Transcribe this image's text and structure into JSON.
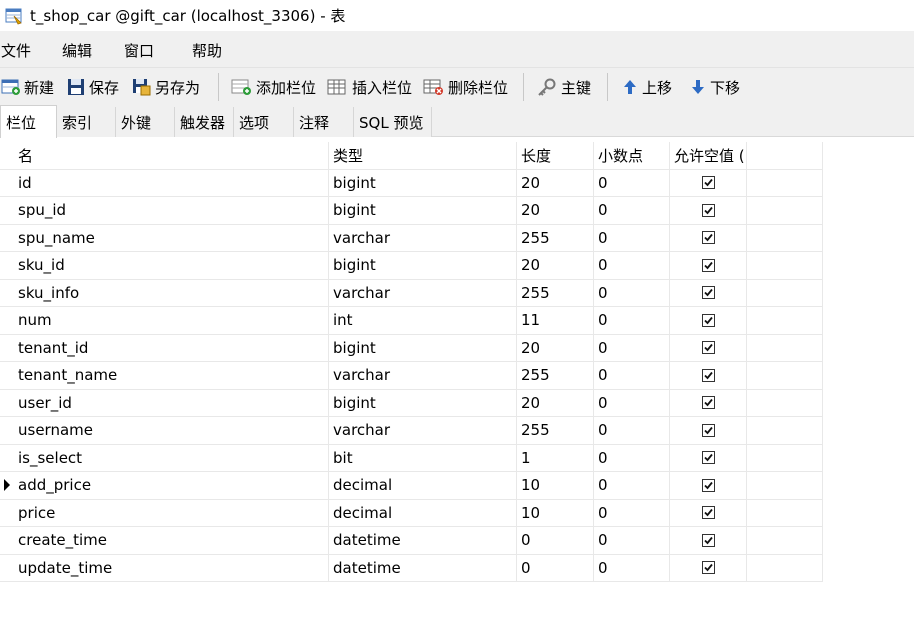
{
  "window": {
    "title": "t_shop_car @gift_car (localhost_3306) - 表",
    "icon": "table-design-icon"
  },
  "menu": [
    "文件",
    "编辑",
    "窗口",
    "帮助"
  ],
  "toolbar": {
    "new": "新建",
    "save": "保存",
    "save_as": "另存为",
    "add_field": "添加栏位",
    "insert_field": "插入栏位",
    "delete_field": "删除栏位",
    "primary_key": "主键",
    "move_up": "上移",
    "move_down": "下移"
  },
  "tabs": [
    "栏位",
    "索引",
    "外键",
    "触发器",
    "选项",
    "注释",
    "SQL 预览"
  ],
  "columns": {
    "name": "名",
    "type": "类型",
    "length": "长度",
    "decimals": "小数点",
    "allow_null": "允许空值 ("
  },
  "rows": [
    {
      "name": "id",
      "type": "bigint",
      "length": "20",
      "decimals": "0",
      "allow_null": true
    },
    {
      "name": "spu_id",
      "type": "bigint",
      "length": "20",
      "decimals": "0",
      "allow_null": true
    },
    {
      "name": "spu_name",
      "type": "varchar",
      "length": "255",
      "decimals": "0",
      "allow_null": true
    },
    {
      "name": "sku_id",
      "type": "bigint",
      "length": "20",
      "decimals": "0",
      "allow_null": true
    },
    {
      "name": "sku_info",
      "type": "varchar",
      "length": "255",
      "decimals": "0",
      "allow_null": true
    },
    {
      "name": "num",
      "type": "int",
      "length": "11",
      "decimals": "0",
      "allow_null": true
    },
    {
      "name": "tenant_id",
      "type": "bigint",
      "length": "20",
      "decimals": "0",
      "allow_null": true
    },
    {
      "name": "tenant_name",
      "type": "varchar",
      "length": "255",
      "decimals": "0",
      "allow_null": true
    },
    {
      "name": "user_id",
      "type": "bigint",
      "length": "20",
      "decimals": "0",
      "allow_null": true
    },
    {
      "name": "username",
      "type": "varchar",
      "length": "255",
      "decimals": "0",
      "allow_null": true
    },
    {
      "name": "is_select",
      "type": "bit",
      "length": "1",
      "decimals": "0",
      "allow_null": true
    },
    {
      "name": "add_price",
      "type": "decimal",
      "length": "10",
      "decimals": "0",
      "allow_null": true,
      "current": true
    },
    {
      "name": "price",
      "type": "decimal",
      "length": "10",
      "decimals": "0",
      "allow_null": true
    },
    {
      "name": "create_time",
      "type": "datetime",
      "length": "0",
      "decimals": "0",
      "allow_null": true
    },
    {
      "name": "update_time",
      "type": "datetime",
      "length": "0",
      "decimals": "0",
      "allow_null": true
    }
  ]
}
